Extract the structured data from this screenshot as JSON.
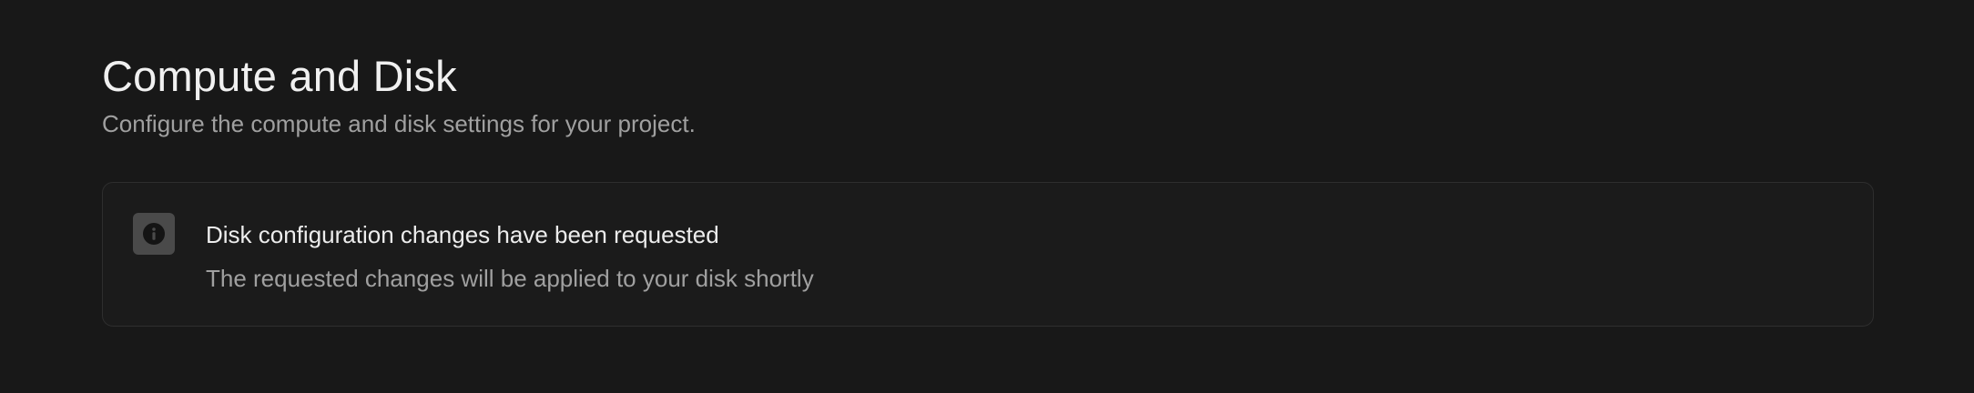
{
  "header": {
    "title": "Compute and Disk",
    "subtitle": "Configure the compute and disk settings for your project."
  },
  "notice": {
    "icon": "info-icon",
    "title": "Disk configuration changes have been requested",
    "description": "The requested changes will be applied to your disk shortly"
  },
  "colors": {
    "background": "#181818",
    "border": "#2e2e2e",
    "icon_tile": "#4a4a4a",
    "text_primary": "#ededed",
    "text_secondary": "#a0a0a0"
  }
}
